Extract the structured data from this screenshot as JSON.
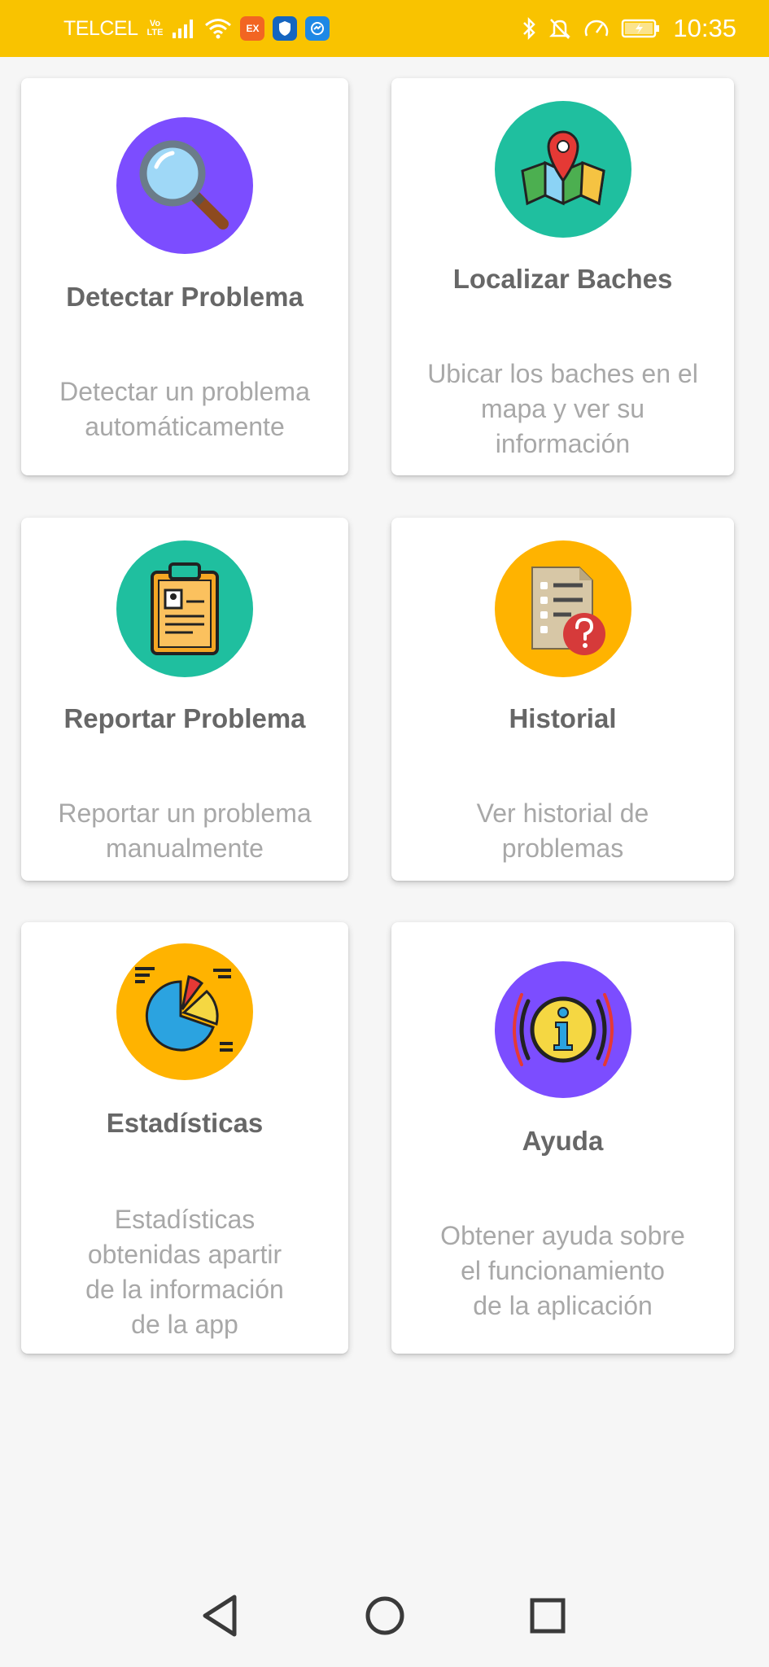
{
  "status_bar": {
    "carrier": "TELCEL",
    "volte": "Vo LTE",
    "app_badge": "EX",
    "time": "10:35",
    "color": "#f9c300"
  },
  "cards": [
    {
      "title": "Detectar Problema",
      "desc": [
        "Detectar un problema",
        "automáticamente"
      ],
      "icon": "magnifier-icon",
      "circle_color": "#7c4dff"
    },
    {
      "title": "Localizar Baches",
      "desc": [
        "Ubicar los baches en el",
        "mapa y ver su",
        "información"
      ],
      "icon": "map-pin-icon",
      "circle_color": "#1fbf9f"
    },
    {
      "title": "Reportar Problema",
      "desc": [
        "Reportar un problema",
        "manualmente"
      ],
      "icon": "clipboard-icon",
      "circle_color": "#1fbf9f"
    },
    {
      "title": "Historial",
      "desc": [
        "Ver historial de",
        "problemas"
      ],
      "icon": "document-question-icon",
      "circle_color": "#ffb300"
    },
    {
      "title": "Estadísticas",
      "desc": [
        "Estadísticas",
        "obtenidas apartir",
        "de la información",
        "de la app"
      ],
      "icon": "pie-chart-icon",
      "circle_color": "#ffb300"
    },
    {
      "title": "Ayuda",
      "desc": [
        "Obtener ayuda sobre",
        "el funcionamiento",
        "de la aplicación"
      ],
      "icon": "info-icon",
      "circle_color": "#7c4dff"
    }
  ],
  "navigation": {
    "back": "back-icon",
    "home": "home-icon",
    "recents": "recents-icon"
  }
}
